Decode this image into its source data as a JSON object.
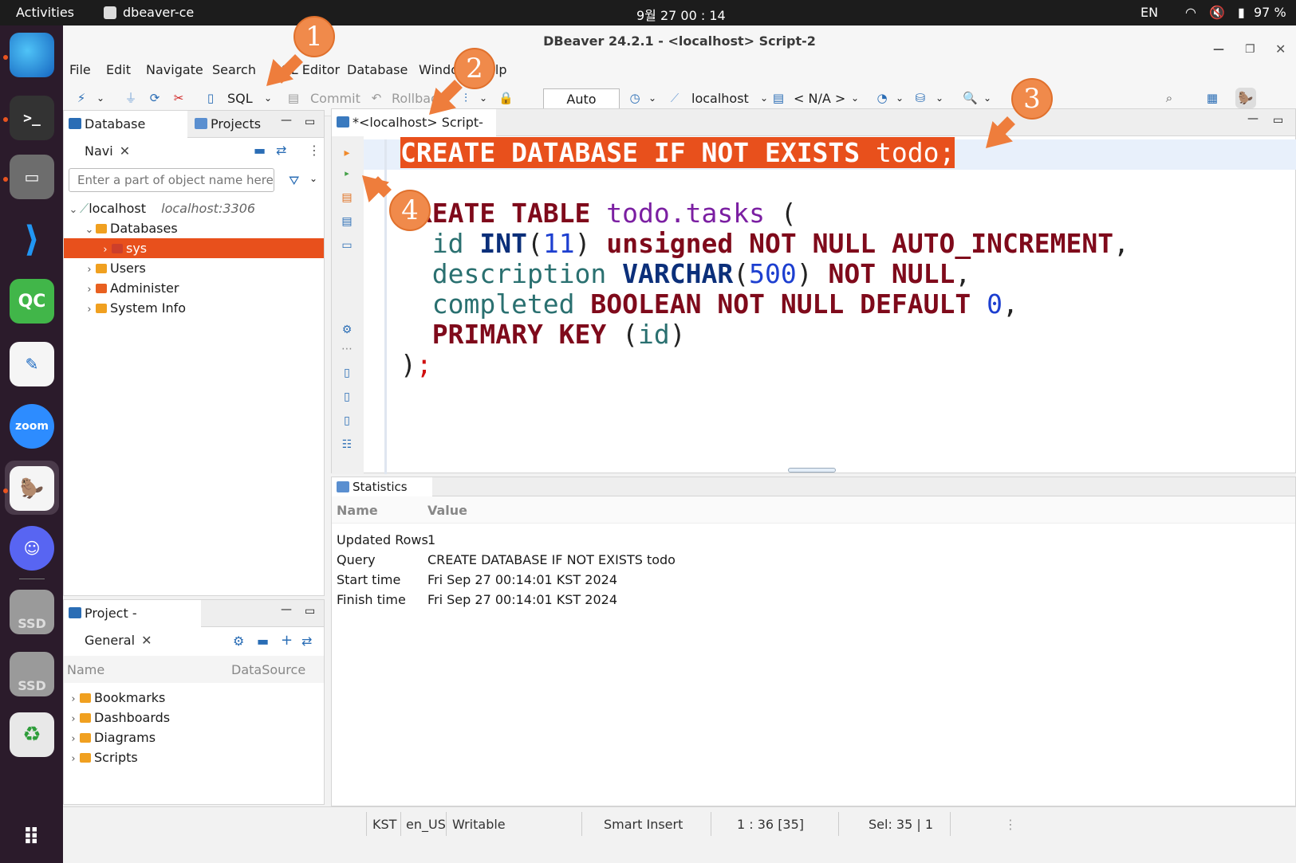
{
  "system": {
    "activities": "Activities",
    "app_name": "dbeaver-ce",
    "clock": "9월 27  00 : 14",
    "lang": "EN",
    "battery": "97 %"
  },
  "dock": {
    "apps": [
      "edge-icon",
      "terminal-icon",
      "files-icon",
      "vscode-icon",
      "qt-creator-icon",
      "text-editor-icon",
      "zoom-icon",
      "dbeaver-icon",
      "discord-icon",
      "ssd-drive-icon",
      "ssd-drive-icon",
      "trash-icon",
      "app-grid-icon"
    ],
    "qc_label": "QC",
    "zoom_label": "zoom",
    "ssd_label": "SSD"
  },
  "window": {
    "title": "DBeaver 24.2.1 - <localhost> Script-2"
  },
  "menu": {
    "file": "File",
    "edit": "Edit",
    "navigate": "Navigate",
    "search": "Search",
    "sql_editor": "SQL Editor",
    "database": "Database",
    "window": "Window",
    "help": "Help"
  },
  "toolbar": {
    "sql": "SQL",
    "commit": "Commit",
    "rollback": "Rollback",
    "auto": "Auto",
    "connection": "localhost",
    "schema": "< N/A >"
  },
  "navigator": {
    "tab_db": "Database Navi",
    "tab_projects": "Projects",
    "filter_placeholder": "Enter a part of object name here",
    "tree": {
      "connection": "localhost",
      "connection_addr": "localhost:3306",
      "databases": "Databases",
      "sys": "sys",
      "users": "Users",
      "administer": "Administer",
      "system_info": "System Info"
    }
  },
  "project": {
    "tab": "Project - General",
    "col_name": "Name",
    "col_datasource": "DataSource",
    "items": [
      "Bookmarks",
      "Dashboards",
      "Diagrams",
      "Scripts"
    ]
  },
  "editor": {
    "tab": "*<localhost> Script-2",
    "code": {
      "l1": [
        "CREATE DATABASE IF NOT EXISTS",
        " todo",
        ";"
      ],
      "l3": [
        "CREATE TABLE",
        " todo.tasks",
        " ("
      ],
      "l4": [
        "  id",
        " INT",
        "(",
        "11",
        ")",
        " unsigned NOT NULL AUTO_INCREMENT",
        ","
      ],
      "l5": [
        "  description",
        " VARCHAR",
        "(",
        "500",
        ")",
        " NOT NULL",
        ","
      ],
      "l6": [
        "  completed",
        " BOOLEAN NOT NULL DEFAULT",
        " 0",
        ","
      ],
      "l7": [
        "  PRIMARY KEY",
        " (",
        "id",
        ")"
      ],
      "l8": [
        ")",
        ";"
      ]
    }
  },
  "results": {
    "tab": "Statistics 1",
    "col_name": "Name",
    "col_value": "Value",
    "rows": [
      {
        "name": "Updated Rows",
        "value": "1"
      },
      {
        "name": "Query",
        "value": "CREATE DATABASE IF NOT EXISTS todo"
      },
      {
        "name": "Start time",
        "value": "Fri Sep 27 00:14:01 KST 2024"
      },
      {
        "name": "Finish time",
        "value": "Fri Sep 27 00:14:01 KST 2024"
      }
    ]
  },
  "status": {
    "tz": "KST",
    "locale": "en_US",
    "mode": "Writable",
    "insert": "Smart Insert",
    "position": "1 : 36 [35]",
    "selection": "Sel: 35 | 1"
  },
  "callouts": [
    "1",
    "2",
    "3",
    "4"
  ],
  "colors": {
    "accent": "#e95420",
    "callout": "#f08a4b",
    "selection": "#e8501c"
  }
}
